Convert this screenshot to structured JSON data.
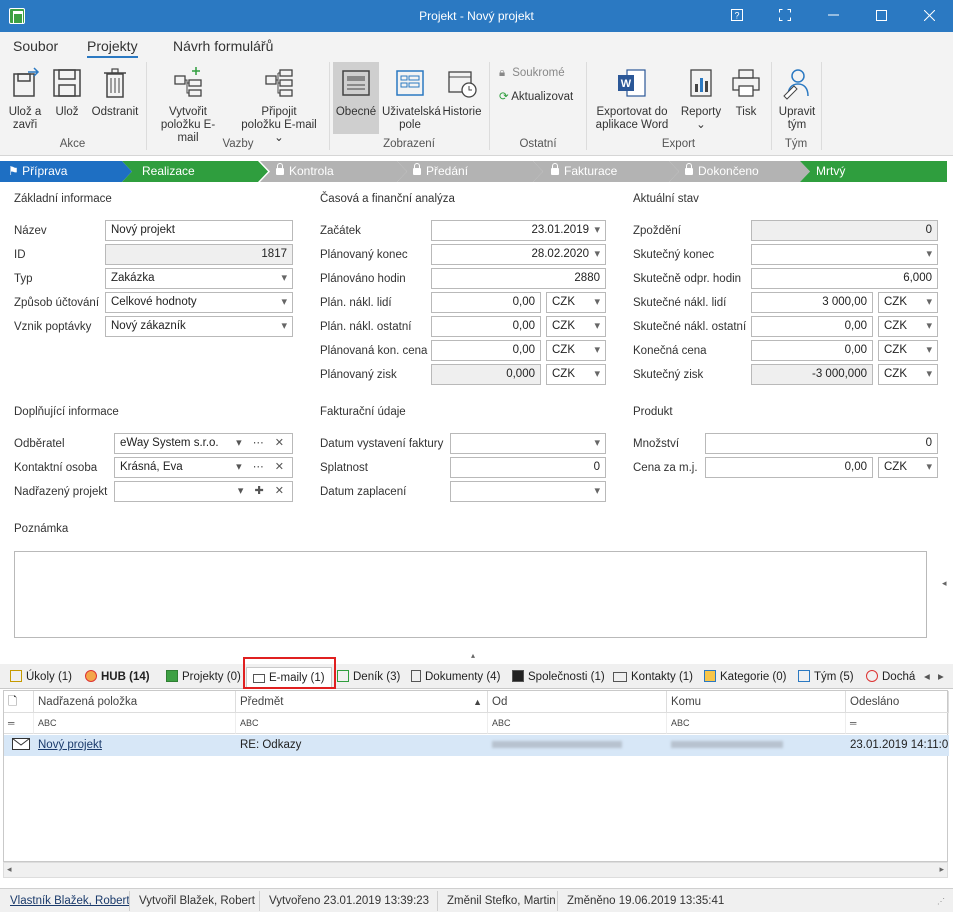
{
  "window": {
    "title": "Projekt - Nový projekt"
  },
  "ribbon": {
    "tabs": [
      "Soubor",
      "Projekty",
      "Návrh formulářů"
    ],
    "active_tab": "Projekty",
    "buttons": {
      "save_close": [
        "Ulož a",
        "zavři"
      ],
      "save": "Ulož",
      "delete": "Odstranit",
      "create_email": [
        "Vytvořit",
        "položku E-mail"
      ],
      "attach_email": [
        "Připojit",
        "položku E-mail"
      ],
      "general": "Obecné",
      "user_field": [
        "Uživatelská",
        "pole"
      ],
      "history": "Historie",
      "private": "Soukromé",
      "refresh": "Aktualizovat",
      "export_word": [
        "Exportovat do",
        "aplikace Word"
      ],
      "reports": "Reporty",
      "print": "Tisk",
      "edit_team": [
        "Upravit",
        "tým"
      ]
    },
    "groups": [
      "Akce",
      "Vazby",
      "Zobrazení",
      "Ostatní",
      "Export",
      "Tým"
    ]
  },
  "process": [
    "Příprava",
    "Realizace",
    "Kontrola",
    "Předání",
    "Fakturace",
    "Dokončeno",
    "Mrtvý"
  ],
  "basic": {
    "section": "Základní informace",
    "name_label": "Název",
    "name": "Nový projekt",
    "id_label": "ID",
    "id": "1817",
    "type_label": "Typ",
    "type": "Zakázka",
    "billing_label": "Způsob účtování",
    "billing": "Celkové hodnoty",
    "origin_label": "Vznik poptávky",
    "origin": "Nový zákazník"
  },
  "timefin": {
    "section": "Časová a finanční analýza",
    "start_label": "Začátek",
    "start": "23.01.2019",
    "planned_end_label": "Plánovaný konec",
    "planned_end": "28.02.2020",
    "planned_hours_label": "Plánováno hodin",
    "planned_hours": "2880",
    "plan_cost_people_label": "Plán. nákl. lidí",
    "plan_cost_people": "0,00",
    "plan_cost_other_label": "Plán. nákl. ostatní",
    "plan_cost_other": "0,00",
    "plan_final_price_label": "Plánovaná kon. cena",
    "plan_final_price": "0,00",
    "plan_profit_label": "Plánovaný zisk",
    "plan_profit": "0,000",
    "currency": "CZK"
  },
  "current": {
    "section": "Aktuální stav",
    "delay_label": "Zpoždění",
    "delay": "0",
    "actual_end_label": "Skutečný konec",
    "actual_end": "",
    "actual_hours_label": "Skutečně odpr. hodin",
    "actual_hours": "6,000",
    "actual_cost_people_label": "Skutečné nákl. lidí",
    "actual_cost_people": "3 000,00",
    "actual_cost_other_label": "Skutečné nákl. ostatní",
    "actual_cost_other": "0,00",
    "final_price_label": "Konečná cena",
    "final_price": "0,00",
    "actual_profit_label": "Skutečný zisk",
    "actual_profit": "-3 000,000",
    "currency": "CZK"
  },
  "additional": {
    "section": "Doplňující informace",
    "customer_label": "Odběratel",
    "customer": "eWay System s.r.o.",
    "contact_label": "Kontaktní osoba",
    "contact": "Krásná, Eva",
    "parent_label": "Nadřazený projekt",
    "parent": ""
  },
  "invoice": {
    "section": "Fakturační údaje",
    "issue_date_label": "Datum vystavení faktury",
    "issue_date": "",
    "due_label": "Splatnost",
    "due": "0",
    "paid_date_label": "Datum zaplacení",
    "paid_date": ""
  },
  "product": {
    "section": "Produkt",
    "qty_label": "Množství",
    "qty": "0",
    "unit_price_label": "Cena za m.j.",
    "unit_price": "0,00",
    "currency": "CZK"
  },
  "note": {
    "label": "Poznámka"
  },
  "tabs": [
    "Úkoly (1)",
    "HUB (14)",
    "Projekty (0)",
    "E-maily (1)",
    "Deník (3)",
    "Dokumenty (4)",
    "Společnosti (1)",
    "Kontakty (1)",
    "Kategorie (0)",
    "Tým (5)",
    "Dochá"
  ],
  "grid": {
    "columns": [
      "Nadřazená položka",
      "Předmět",
      "Od",
      "Komu",
      "Odesláno"
    ],
    "filter_glyph": "ABC",
    "row": {
      "parent": "Nový projekt",
      "subject": "RE: Odkazy",
      "sent": "23.01.2019 14:11:0"
    }
  },
  "status": {
    "owner": "Vlastník Blažek, Robert",
    "created_by": "Vytvořil Blažek, Robert",
    "created": "Vytvořeno 23.01.2019 13:39:23",
    "changed_by": "Změnil Stefko, Martin",
    "changed": "Změněno 19.06.2019 13:35:41"
  },
  "colors": {
    "accent": "#2b79c2",
    "process_active": "#1e6fc3",
    "process_green": "#2f9e3e",
    "process_locked": "#b3b3b3",
    "highlight": "#e02020"
  }
}
